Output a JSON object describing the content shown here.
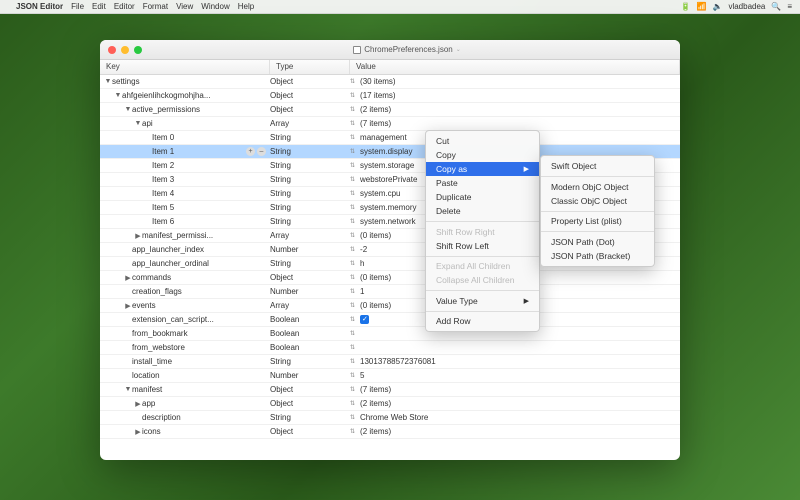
{
  "menubar": {
    "app": "JSON Editor",
    "items": [
      "File",
      "Edit",
      "Editor",
      "Format",
      "View",
      "Window",
      "Help"
    ],
    "right": {
      "battery": "⚡",
      "user": "vladbadea",
      "search": "🔍"
    }
  },
  "window": {
    "title": "ChromePreferences.json"
  },
  "columns": {
    "key": "Key",
    "type": "Type",
    "value": "Value"
  },
  "rows": [
    {
      "k": "settings",
      "t": "Object",
      "v": "(30 items)",
      "d": 0,
      "exp": true
    },
    {
      "k": "ahfgeienlihckogmohjha...",
      "t": "Object",
      "v": "(17 items)",
      "d": 1,
      "exp": true
    },
    {
      "k": "active_permissions",
      "t": "Object",
      "v": "(2 items)",
      "d": 2,
      "exp": true
    },
    {
      "k": "api",
      "t": "Array",
      "v": "(7 items)",
      "d": 3,
      "exp": true
    },
    {
      "k": "Item 0",
      "t": "String",
      "v": "management",
      "d": 4
    },
    {
      "k": "Item 1",
      "t": "String",
      "v": "system.display",
      "d": 4,
      "sel": true,
      "btns": true
    },
    {
      "k": "Item 2",
      "t": "String",
      "v": "system.storage",
      "d": 4
    },
    {
      "k": "Item 3",
      "t": "String",
      "v": "webstorePrivate",
      "d": 4
    },
    {
      "k": "Item 4",
      "t": "String",
      "v": "system.cpu",
      "d": 4
    },
    {
      "k": "Item 5",
      "t": "String",
      "v": "system.memory",
      "d": 4
    },
    {
      "k": "Item 6",
      "t": "String",
      "v": "system.network",
      "d": 4
    },
    {
      "k": "manifest_permissi...",
      "t": "Array",
      "v": "(0 items)",
      "d": 3,
      "col": true
    },
    {
      "k": "app_launcher_index",
      "t": "Number",
      "v": "-2",
      "d": 2
    },
    {
      "k": "app_launcher_ordinal",
      "t": "String",
      "v": "h",
      "d": 2
    },
    {
      "k": "commands",
      "t": "Object",
      "v": "(0 items)",
      "d": 2,
      "col": true
    },
    {
      "k": "creation_flags",
      "t": "Number",
      "v": "1",
      "d": 2
    },
    {
      "k": "events",
      "t": "Array",
      "v": "(0 items)",
      "d": 2,
      "col": true
    },
    {
      "k": "extension_can_script...",
      "t": "Boolean",
      "v": "",
      "d": 2,
      "cb": true
    },
    {
      "k": "from_bookmark",
      "t": "Boolean",
      "v": "",
      "d": 2
    },
    {
      "k": "from_webstore",
      "t": "Boolean",
      "v": "",
      "d": 2
    },
    {
      "k": "install_time",
      "t": "String",
      "v": "13013788572376081",
      "d": 2
    },
    {
      "k": "location",
      "t": "Number",
      "v": "5",
      "d": 2
    },
    {
      "k": "manifest",
      "t": "Object",
      "v": "(7 items)",
      "d": 2,
      "exp": true
    },
    {
      "k": "app",
      "t": "Object",
      "v": "(2 items)",
      "d": 3,
      "col": true
    },
    {
      "k": "description",
      "t": "String",
      "v": "Chrome Web Store",
      "d": 3
    },
    {
      "k": "icons",
      "t": "Object",
      "v": "(2 items)",
      "d": 3,
      "col": true
    }
  ],
  "context_menu": {
    "items": [
      {
        "label": "Cut"
      },
      {
        "label": "Copy"
      },
      {
        "label": "Copy as",
        "submenu": true,
        "hover": true
      },
      {
        "label": "Paste"
      },
      {
        "label": "Duplicate"
      },
      {
        "label": "Delete"
      },
      {
        "sep": true
      },
      {
        "label": "Shift Row Right",
        "disabled": true
      },
      {
        "label": "Shift Row Left"
      },
      {
        "sep": true
      },
      {
        "label": "Expand All Children",
        "disabled": true
      },
      {
        "label": "Collapse All Children",
        "disabled": true
      },
      {
        "sep": true
      },
      {
        "label": "Value Type",
        "submenu": true
      },
      {
        "sep": true
      },
      {
        "label": "Add Row"
      }
    ],
    "submenu": [
      {
        "label": "Swift Object"
      },
      {
        "sep": true
      },
      {
        "label": "Modern ObjC Object"
      },
      {
        "label": "Classic ObjC Object"
      },
      {
        "sep": true
      },
      {
        "label": "Property List (plist)"
      },
      {
        "sep": true
      },
      {
        "label": "JSON Path (Dot)"
      },
      {
        "label": "JSON Path (Bracket)"
      }
    ]
  }
}
